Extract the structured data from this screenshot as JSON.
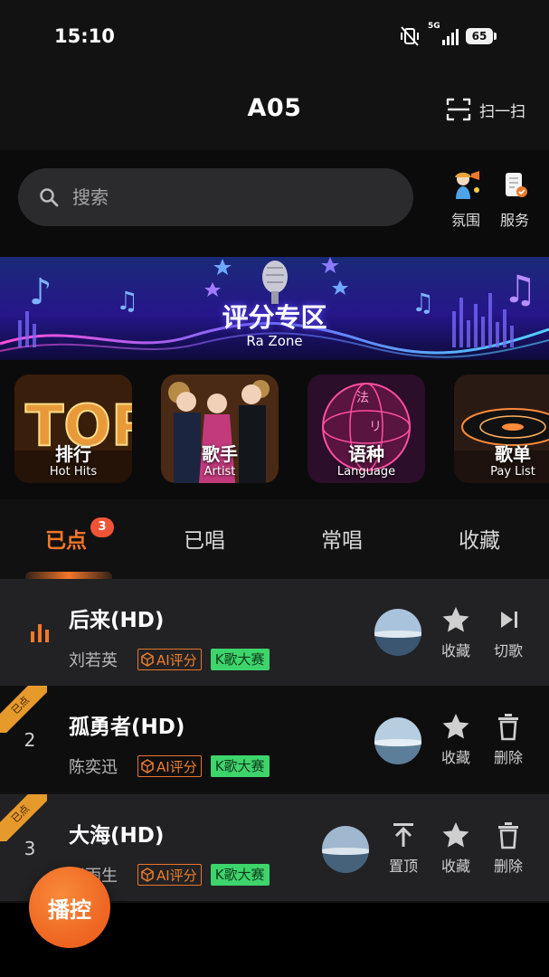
{
  "status_bar": {
    "time": "15:10",
    "network": "5G",
    "battery": "65"
  },
  "header": {
    "title": "A05",
    "scan_label": "扫一扫"
  },
  "search": {
    "placeholder": "搜索"
  },
  "quick_actions": [
    {
      "label": "氛围",
      "icon": "atmosphere-icon"
    },
    {
      "label": "服务",
      "icon": "service-icon"
    }
  ],
  "banner": {
    "title": "评分专区",
    "subtitle": "Ra Zone"
  },
  "categories": [
    {
      "label": "排行",
      "sub": "Hot Hits"
    },
    {
      "label": "歌手",
      "sub": "Artist"
    },
    {
      "label": "语种",
      "sub": "Language"
    },
    {
      "label": "歌单",
      "sub": "Pay List"
    }
  ],
  "tabs": [
    {
      "label": "已点",
      "badge": "3",
      "active": true
    },
    {
      "label": "已唱"
    },
    {
      "label": "常唱"
    },
    {
      "label": "收藏"
    }
  ],
  "songs": [
    {
      "index": "",
      "status": "playing",
      "title": "后来(HD)",
      "artist": "刘若英",
      "ai_tag": "AI评分",
      "contest_tag": "K歌大赛",
      "actions": [
        "收藏",
        "切歌"
      ]
    },
    {
      "index": "2",
      "ribbon": "已点",
      "title": "孤勇者(HD)",
      "artist": "陈奕迅",
      "ai_tag": "AI评分",
      "contest_tag": "K歌大赛",
      "actions": [
        "收藏",
        "删除"
      ]
    },
    {
      "index": "3",
      "ribbon": "已点",
      "title": "大海(HD)",
      "artist": "张雨生",
      "ai_tag": "AI评分",
      "contest_tag": "K歌大赛",
      "actions": [
        "置顶",
        "收藏",
        "删除"
      ]
    }
  ],
  "floating_button": {
    "label": "播控"
  },
  "colors": {
    "accent": "#f4772a",
    "contest_green": "#3ed46c",
    "badge_red": "#ef5436"
  }
}
